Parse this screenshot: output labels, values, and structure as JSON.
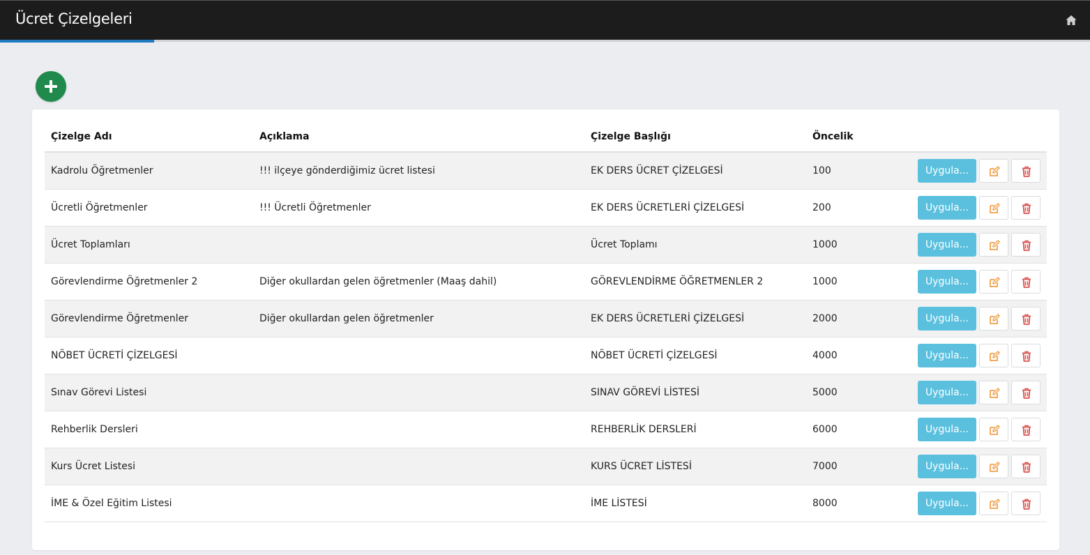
{
  "header": {
    "title": "Ücret Çizelgeleri",
    "home_icon": "home-icon"
  },
  "add_button": {
    "icon": "plus-icon",
    "color": "#1f8a4c"
  },
  "table": {
    "columns": [
      "Çizelge Adı",
      "Açıklama",
      "Çizelge Başlığı",
      "Öncelik"
    ],
    "action_labels": {
      "apply": "Uygula...",
      "edit_icon": "edit-icon",
      "delete_icon": "trash-icon"
    },
    "rows": [
      {
        "name": "Kadrolu Öğretmenler",
        "description": "!!! ilçeye gönderdiğimiz ücret listesi",
        "heading": "EK DERS ÜCRET ÇİZELGESİ",
        "priority": "100"
      },
      {
        "name": "Ücretli Öğretmenler",
        "description": "!!! Ücretli Öğretmenler",
        "heading": "EK DERS ÜCRETLERİ ÇİZELGESİ",
        "priority": "200"
      },
      {
        "name": "Ücret Toplamları",
        "description": "",
        "heading": "Ücret Toplamı",
        "priority": "1000"
      },
      {
        "name": "Görevlendirme Öğretmenler 2",
        "description": "Diğer okullardan gelen öğretmenler (Maaş dahil)",
        "heading": "GÖREVLENDİRME ÖĞRETMENLER 2",
        "priority": "1000"
      },
      {
        "name": "Görevlendirme Öğretmenler",
        "description": "Diğer okullardan gelen öğretmenler",
        "heading": "EK DERS ÜCRETLERİ ÇİZELGESİ",
        "priority": "2000"
      },
      {
        "name": "NÖBET ÜCRETİ ÇİZELGESİ",
        "description": "",
        "heading": "NÖBET ÜCRETİ ÇİZELGESİ",
        "priority": "4000"
      },
      {
        "name": "Sınav Görevi Listesi",
        "description": "",
        "heading": "SINAV GÖREVİ LİSTESİ",
        "priority": "5000"
      },
      {
        "name": "Rehberlik Dersleri",
        "description": "",
        "heading": "REHBERLİK DERSLERİ",
        "priority": "6000"
      },
      {
        "name": "Kurs Ücret Listesi",
        "description": "",
        "heading": "KURS ÜCRET LİSTESİ",
        "priority": "7000"
      },
      {
        "name": "İME & Özel Eğitim Listesi",
        "description": "",
        "heading": "İME LİSTESİ",
        "priority": "8000"
      }
    ]
  },
  "colors": {
    "apply": "#5bc0de",
    "edit": "#f0a04b",
    "delete": "#d9534f",
    "accent": "#1e7bc0"
  }
}
